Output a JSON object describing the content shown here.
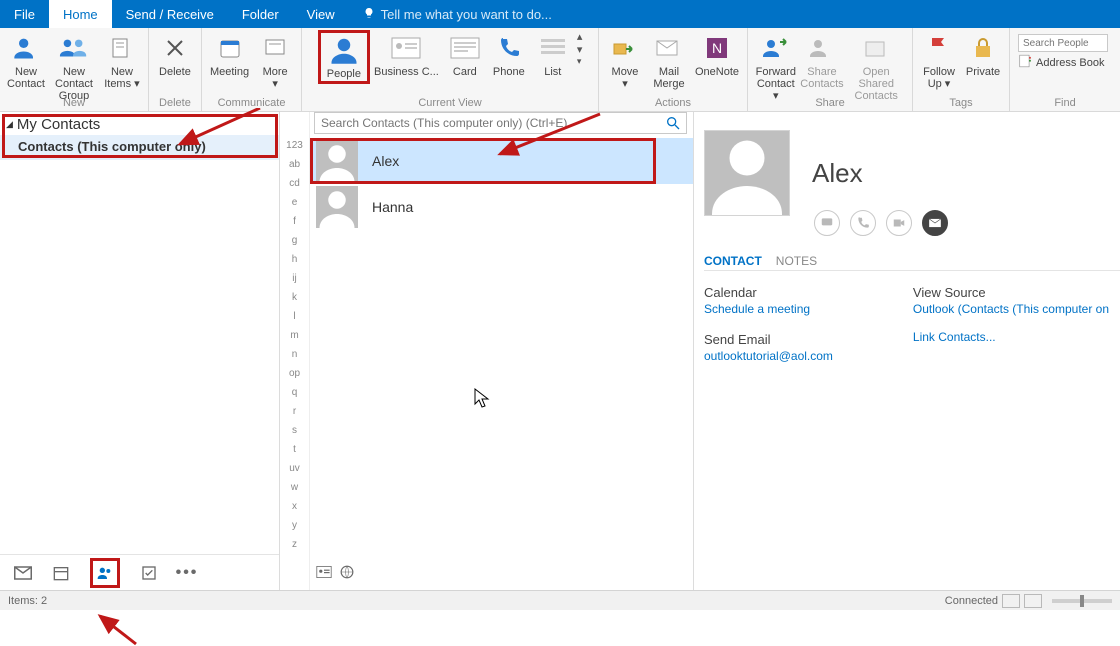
{
  "menubar": {
    "tabs": [
      "File",
      "Home",
      "Send / Receive",
      "Folder",
      "View"
    ],
    "active_index": 1,
    "tellme": "Tell me what you want to do..."
  },
  "ribbon": {
    "groups": {
      "new": {
        "label": "New",
        "items": [
          "New\nContact",
          "New Contact\nGroup",
          "New\nItems ▾"
        ]
      },
      "delete": {
        "label": "Delete",
        "items": [
          "Delete"
        ]
      },
      "communicate": {
        "label": "Communicate",
        "items": [
          "Meeting",
          "More\n▾"
        ]
      },
      "current_view": {
        "label": "Current View",
        "items": [
          "People",
          "Business C...",
          "Card",
          "Phone",
          "List"
        ],
        "highlight_index": 0
      },
      "actions": {
        "label": "Actions",
        "items": [
          "Move\n▾",
          "Mail\nMerge",
          "OneNote"
        ]
      },
      "share": {
        "label": "Share",
        "items": [
          "Forward\nContact ▾",
          "Share\nContacts",
          "Open Shared\nContacts"
        ]
      },
      "tags": {
        "label": "Tags",
        "items": [
          "Follow\nUp ▾",
          "Private"
        ]
      },
      "find": {
        "label": "Find"
      }
    },
    "search_people_placeholder": "Search People",
    "address_book": "Address Book"
  },
  "leftpane": {
    "header": "My Contacts",
    "selected_folder": "Contacts (This computer only)",
    "bottom_icons": [
      "mail",
      "calendar",
      "people",
      "tasks",
      "more"
    ]
  },
  "middle": {
    "search_placeholder": "Search Contacts (This computer only) (Ctrl+E)",
    "az": [
      "123",
      "ab",
      "cd",
      "e",
      "f",
      "g",
      "h",
      "ij",
      "k",
      "l",
      "m",
      "n",
      "op",
      "q",
      "r",
      "s",
      "t",
      "uv",
      "w",
      "x",
      "y",
      "z"
    ],
    "contacts": [
      {
        "name": "Alex"
      },
      {
        "name": "Hanna"
      }
    ],
    "selected_index": 0
  },
  "detail": {
    "name": "Alex",
    "tabs": [
      "CONTACT",
      "NOTES"
    ],
    "active_tab": 0,
    "calendar_label": "Calendar",
    "schedule_link": "Schedule a meeting",
    "send_email_label": "Send Email",
    "email": "outlooktutorial@aol.com",
    "view_source_label": "View Source",
    "view_source_link": "Outlook (Contacts (This computer on",
    "link_contacts": "Link Contacts..."
  },
  "statusbar": {
    "items": "Items: 2",
    "connected": "Connected"
  }
}
